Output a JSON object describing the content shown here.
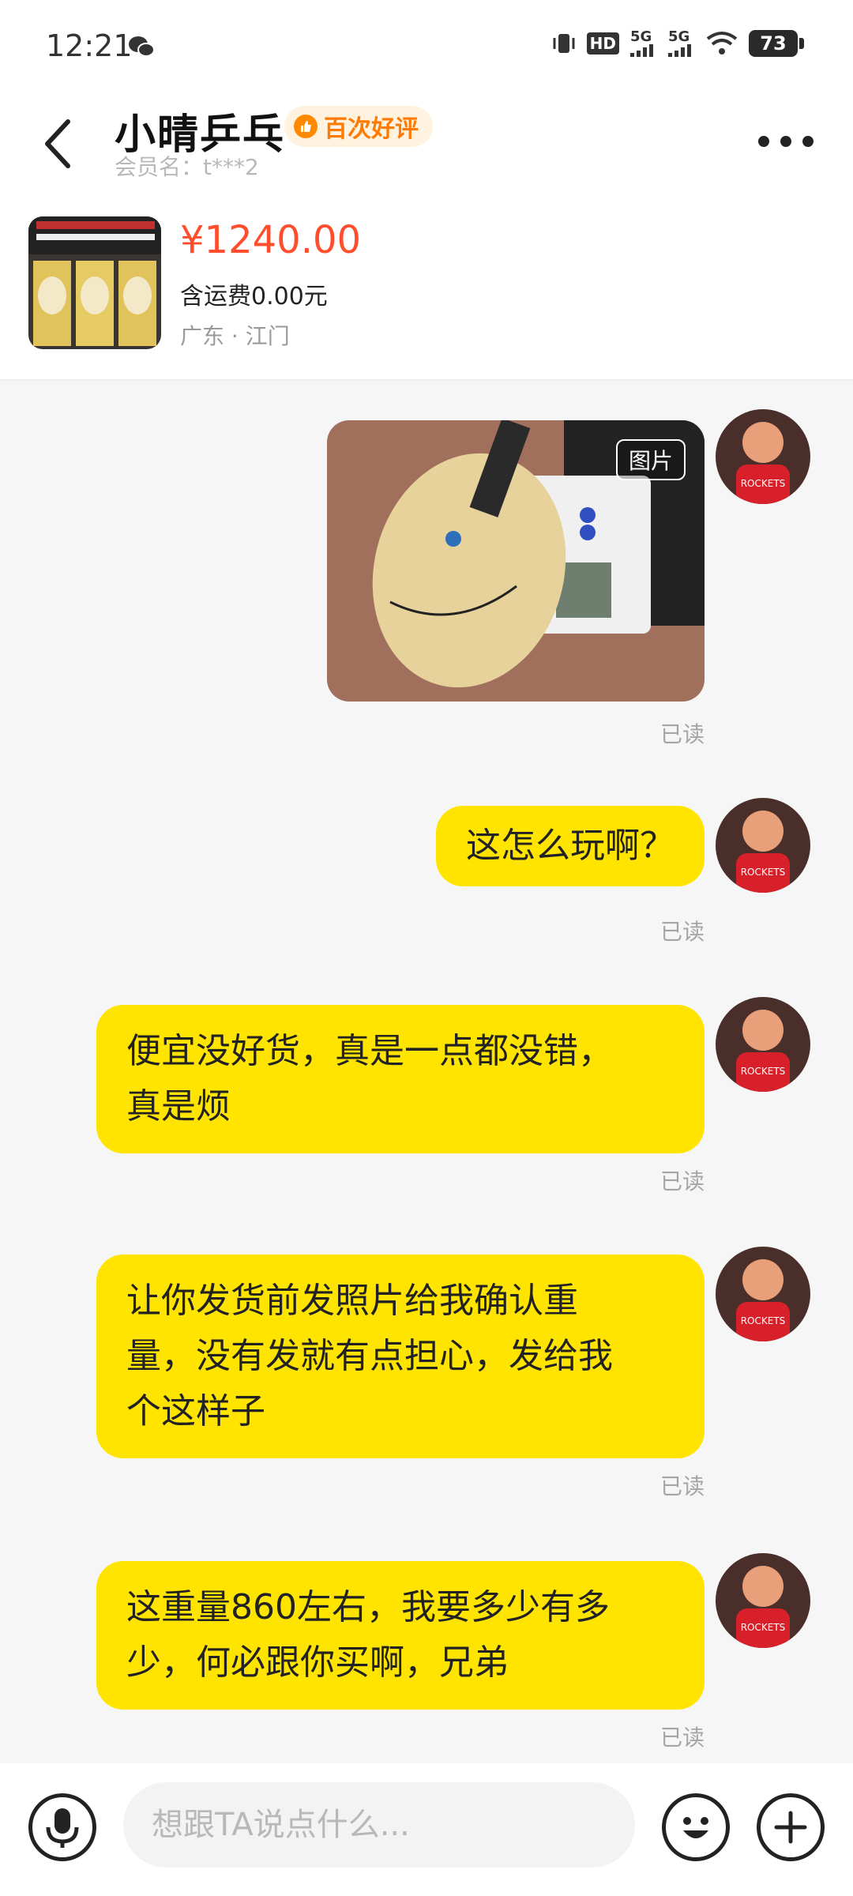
{
  "status_bar": {
    "time": "12:21",
    "battery": "73",
    "network_1": "5G",
    "network_2": "5G",
    "hd": "HD"
  },
  "header": {
    "title": "小晴乒乓",
    "badge": "百次好评",
    "member": "会员名：t***2"
  },
  "product": {
    "price": "¥1240.00",
    "shipping": "含运费0.00元",
    "location": "广东 · 江门"
  },
  "messages": [
    {
      "type": "image",
      "tag": "图片",
      "status": "已读"
    },
    {
      "type": "text",
      "text": "这怎么玩啊？",
      "status": "已读"
    },
    {
      "type": "text",
      "line1": "便宜没好货，真是一点都没错，",
      "line2": "真是烦",
      "status": "已读"
    },
    {
      "type": "text",
      "line1": "让你发货前发照片给我确认重",
      "line2": "量，没有发就有点担心，发给我",
      "line3": "个这样子",
      "status": "已读"
    },
    {
      "type": "text",
      "line1": "这重量860左右，我要多少有多",
      "line2": "少，何必跟你买啊，兄弟",
      "status": "已读"
    }
  ],
  "input": {
    "placeholder": "想跟TA说点什么..."
  },
  "colors": {
    "bubble": "#ffe400",
    "price": "#ff4d2d",
    "badge": "#ff7a00"
  }
}
